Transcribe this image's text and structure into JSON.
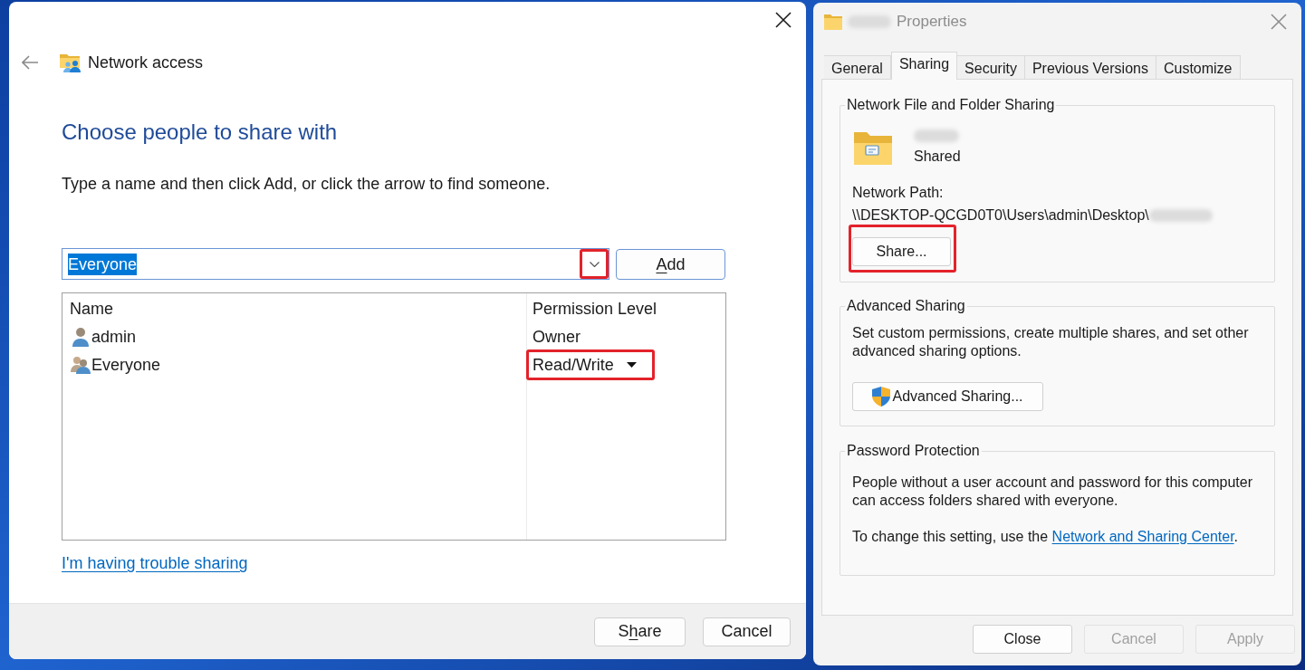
{
  "network_access_dialog": {
    "title": "Network access",
    "heading": "Choose people to share with",
    "instructions": "Type a name and then click Add, or click the arrow to find someone.",
    "name_field": {
      "value": "Everyone",
      "text_selected": true,
      "dropdown_highlighted": true
    },
    "add_button": {
      "access_key": "A",
      "label_end": "dd"
    },
    "table": {
      "columns": [
        "Name",
        "Permission Level"
      ],
      "rows": [
        {
          "name": "admin",
          "kind": "user",
          "permission": "Owner",
          "has_dropdown": false,
          "highlighted": false
        },
        {
          "name": "Everyone",
          "kind": "group",
          "permission": "Read/Write",
          "has_dropdown": true,
          "highlighted": true
        }
      ]
    },
    "help_link": "I'm having trouble sharing",
    "buttons": [
      {
        "label_start": "S",
        "access_key": "h",
        "label_end": "are"
      },
      {
        "label_start": "Cancel"
      }
    ]
  },
  "properties_dialog": {
    "title": "Properties",
    "active": false,
    "tabs": [
      {
        "label": "General",
        "selected": false
      },
      {
        "label": "Sharing",
        "selected": true
      },
      {
        "label": "Security",
        "selected": false
      },
      {
        "label": "Previous Versions",
        "selected": false
      },
      {
        "label": "Customize",
        "selected": false
      }
    ],
    "network_sharing": {
      "legend": "Network File and Folder Sharing",
      "status": "Shared",
      "path_label": "Network Path:",
      "path": "\\\\DESKTOP-QCGD0T0\\Users\\admin\\Desktop\\",
      "share_button": {
        "label": "Share...",
        "highlighted": true
      }
    },
    "advanced_sharing": {
      "legend": "Advanced Sharing",
      "description": "Set custom permissions, create multiple shares, and set other advanced sharing options.",
      "button": "Advanced Sharing..."
    },
    "password_protection": {
      "legend": "Password Protection",
      "description": "People without a user account and password for this computer can access folders shared with everyone.",
      "note": "To change this setting, use the",
      "link": "Network and Sharing Center",
      "note_end": "."
    },
    "buttons": [
      {
        "label": "Close",
        "disabled": false
      },
      {
        "label": "Cancel",
        "disabled": true
      },
      {
        "label": "Apply",
        "disabled": true
      }
    ]
  }
}
